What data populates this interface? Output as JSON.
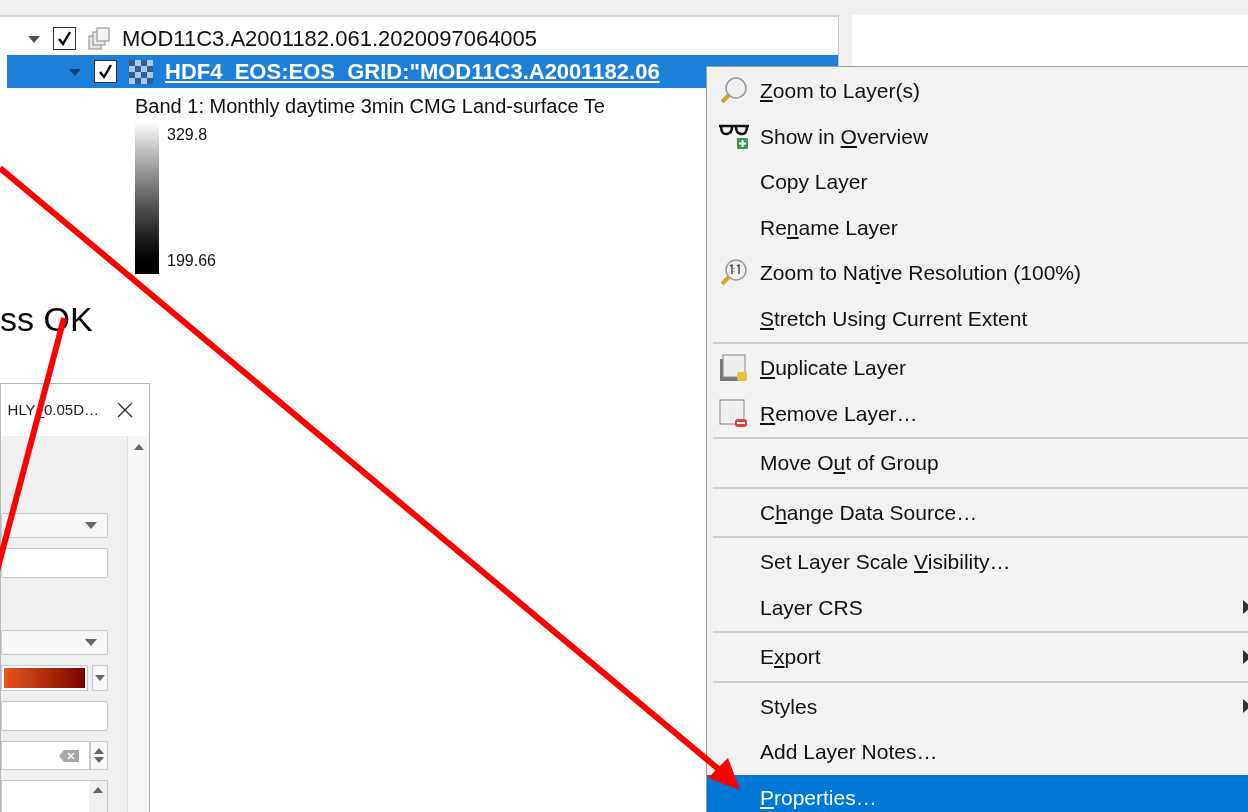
{
  "layers_panel": {
    "layers": [
      {
        "kind": "group",
        "name": "MOD11C3.A2001182.061.2020097064005",
        "checked": true,
        "expanded": true,
        "selected": false,
        "children": [
          {
            "kind": "raster",
            "name": "HDF4_EOS:EOS_GRID:\"MOD11C3.A2001182.06",
            "checked": true,
            "expanded": true,
            "selected": true,
            "band": "Band 1: Monthly daytime 3min CMG Land-surface Te",
            "legend": {
              "max": "329.8",
              "min": "199.66"
            }
          }
        ]
      }
    ]
  },
  "caption": "ss OK",
  "dialog": {
    "title": "HLY_0.05D…",
    "widgets": [
      {
        "kind": "combo"
      },
      {
        "kind": "text"
      },
      {
        "kind": "gap"
      },
      {
        "kind": "combo"
      },
      {
        "kind": "ramp"
      },
      {
        "kind": "text"
      },
      {
        "kind": "spin"
      },
      {
        "kind": "list"
      }
    ]
  },
  "context_menu": {
    "items": [
      {
        "kind": "item",
        "text": {
          "key": "Z",
          "post": "oom to Layer(s)"
        },
        "selected": false,
        "submenu": false
      },
      {
        "kind": "item",
        "text": {
          "pre": "Show in ",
          "key": "O",
          "post": "verview"
        },
        "selected": false,
        "submenu": false
      },
      {
        "kind": "item",
        "text": {
          "pre": "Copy Layer"
        },
        "selected": false,
        "submenu": false
      },
      {
        "kind": "item",
        "text": {
          "pre": "Re",
          "key": "n",
          "post": "ame Layer"
        },
        "selected": false,
        "submenu": false
      },
      {
        "kind": "item",
        "text": {
          "pre": "Zoom to Nat",
          "key": "i",
          "post": "ve Resolution (100%)"
        },
        "selected": false,
        "submenu": false
      },
      {
        "kind": "item",
        "text": {
          "key": "S",
          "post": "tretch Using Current Extent"
        },
        "selected": false,
        "submenu": false
      },
      {
        "kind": "separator"
      },
      {
        "kind": "item",
        "text": {
          "key": "D",
          "post": "uplicate Layer"
        },
        "selected": false,
        "submenu": false
      },
      {
        "kind": "item",
        "text": {
          "key": "R",
          "post": "emove Layer…"
        },
        "selected": false,
        "submenu": false
      },
      {
        "kind": "separator"
      },
      {
        "kind": "item",
        "text": {
          "pre": "Move O",
          "key": "u",
          "post": "t of Group"
        },
        "selected": false,
        "submenu": false
      },
      {
        "kind": "separator"
      },
      {
        "kind": "item",
        "text": {
          "pre": "C",
          "key": "h",
          "post": "ange Data Source…"
        },
        "selected": false,
        "submenu": false
      },
      {
        "kind": "separator"
      },
      {
        "kind": "item",
        "text": {
          "pre": "Set Layer Scale ",
          "key": "V",
          "post": "isibility…"
        },
        "selected": false,
        "submenu": false
      },
      {
        "kind": "item",
        "text": {
          "pre": "Layer CRS"
        },
        "selected": false,
        "submenu": true
      },
      {
        "kind": "separator"
      },
      {
        "kind": "item",
        "text": {
          "pre": "E",
          "key": "x",
          "post": "port"
        },
        "selected": false,
        "submenu": true
      },
      {
        "kind": "separator"
      },
      {
        "kind": "item",
        "text": {
          "pre": "Styles"
        },
        "selected": false,
        "submenu": true
      },
      {
        "kind": "item",
        "text": {
          "pre": "Add Layer Notes…"
        },
        "selected": false,
        "submenu": false
      },
      {
        "kind": "item",
        "text": {
          "key": "P",
          "post": "roperties…"
        },
        "selected": true,
        "submenu": false
      }
    ]
  }
}
